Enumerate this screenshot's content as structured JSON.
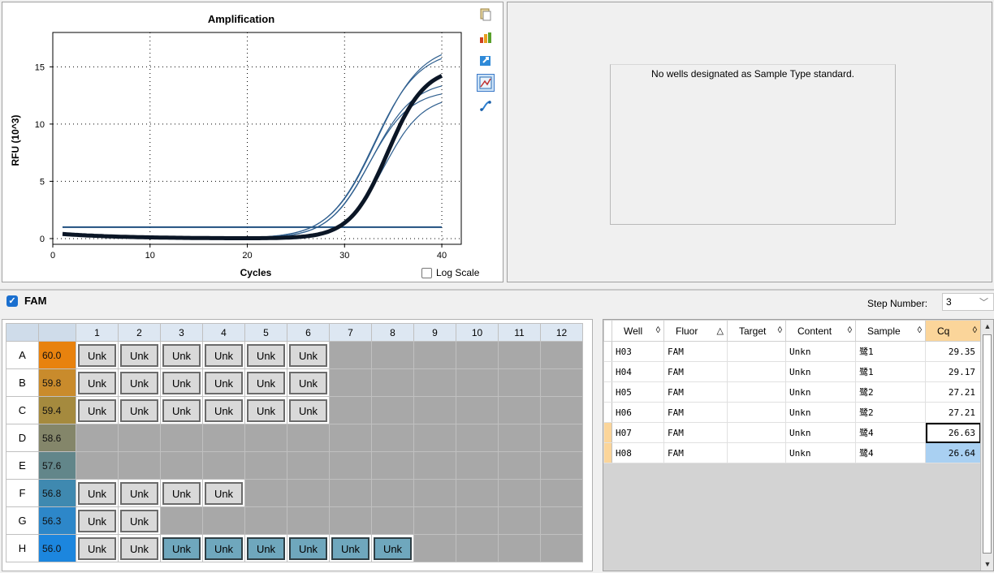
{
  "chart": {
    "title": "Amplification",
    "xlabel": "Cycles",
    "ylabel": "RFU (10^3)",
    "log_scale_label": "Log Scale"
  },
  "chart_data": {
    "type": "line",
    "title": "Amplification",
    "xlabel": "Cycles",
    "ylabel": "RFU (10^3)",
    "xlim": [
      0,
      42
    ],
    "ylim": [
      -0.5,
      18
    ],
    "xticks": [
      0,
      10,
      20,
      30,
      40
    ],
    "yticks": [
      0,
      5,
      10,
      15
    ],
    "grid": true,
    "threshold": 1.0,
    "series": [
      {
        "cq": 26.63,
        "plateau": 17.0,
        "slope": 0.42
      },
      {
        "cq": 26.64,
        "plateau": 16.5,
        "slope": 0.43
      },
      {
        "cq": 27.21,
        "plateau": 13.8,
        "slope": 0.46
      },
      {
        "cq": 27.21,
        "plateau": 13.0,
        "slope": 0.47
      },
      {
        "cq": 29.17,
        "plateau": 12.5,
        "slope": 0.5
      },
      {
        "cq": 29.35,
        "plateau": 15.0,
        "slope": 0.52,
        "bold": true
      }
    ],
    "colors": {
      "curve": "#2f5f8f",
      "bold": "#0b1626",
      "threshold": "#1f4f7f"
    }
  },
  "standard_panel": {
    "message": "No wells designated as Sample Type standard."
  },
  "fluor": {
    "name": "FAM",
    "step_label": "Step Number:",
    "step_value": "3"
  },
  "plate": {
    "columns": [
      "1",
      "2",
      "3",
      "4",
      "5",
      "6",
      "7",
      "8",
      "9",
      "10",
      "11",
      "12"
    ],
    "rows": [
      {
        "label": "A",
        "temp": "60.0",
        "color": "#e8820e",
        "wells": [
          "Unk",
          "Unk",
          "Unk",
          "Unk",
          "Unk",
          "Unk",
          "",
          "",
          "",
          "",
          "",
          ""
        ]
      },
      {
        "label": "B",
        "temp": "59.8",
        "color": "#c98b2c",
        "wells": [
          "Unk",
          "Unk",
          "Unk",
          "Unk",
          "Unk",
          "Unk",
          "",
          "",
          "",
          "",
          "",
          ""
        ]
      },
      {
        "label": "C",
        "temp": "59.4",
        "color": "#a58a3e",
        "wells": [
          "Unk",
          "Unk",
          "Unk",
          "Unk",
          "Unk",
          "Unk",
          "",
          "",
          "",
          "",
          "",
          ""
        ]
      },
      {
        "label": "D",
        "temp": "58.6",
        "color": "#84866a",
        "wells": [
          "",
          "",
          "",
          "",
          "",
          "",
          "",
          "",
          "",
          "",
          "",
          ""
        ]
      },
      {
        "label": "E",
        "temp": "57.6",
        "color": "#62868a",
        "wells": [
          "",
          "",
          "",
          "",
          "",
          "",
          "",
          "",
          "",
          "",
          "",
          ""
        ]
      },
      {
        "label": "F",
        "temp": "56.8",
        "color": "#3f89b0",
        "wells": [
          "Unk",
          "Unk",
          "Unk",
          "Unk",
          "",
          "",
          "",
          "",
          "",
          "",
          "",
          ""
        ]
      },
      {
        "label": "G",
        "temp": "56.3",
        "color": "#2d87c9",
        "wells": [
          "Unk",
          "Unk",
          "",
          "",
          "",
          "",
          "",
          "",
          "",
          "",
          "",
          ""
        ]
      },
      {
        "label": "H",
        "temp": "56.0",
        "color": "#1c86de",
        "wells": [
          "Unk",
          "Unk",
          "Unk",
          "Unk",
          "Unk",
          "Unk",
          "Unk",
          "Unk",
          "",
          "",
          "",
          ""
        ],
        "selected_from": 2
      }
    ]
  },
  "results": {
    "headers": [
      "Well",
      "Fluor",
      "Target",
      "Content",
      "Sample",
      "Cq"
    ],
    "rows": [
      {
        "well": "H03",
        "fluor": "FAM",
        "target": "",
        "content": "Unkn",
        "sample": "鹭1",
        "cq": "29.35"
      },
      {
        "well": "H04",
        "fluor": "FAM",
        "target": "",
        "content": "Unkn",
        "sample": "鹭1",
        "cq": "29.17"
      },
      {
        "well": "H05",
        "fluor": "FAM",
        "target": "",
        "content": "Unkn",
        "sample": "鹭2",
        "cq": "27.21"
      },
      {
        "well": "H06",
        "fluor": "FAM",
        "target": "",
        "content": "Unkn",
        "sample": "鹭2",
        "cq": "27.21"
      },
      {
        "well": "H07",
        "fluor": "FAM",
        "target": "",
        "content": "Unkn",
        "sample": "鹭4",
        "cq": "26.63"
      },
      {
        "well": "H08",
        "fluor": "FAM",
        "target": "",
        "content": "Unkn",
        "sample": "鹭4",
        "cq": "26.64"
      }
    ]
  }
}
